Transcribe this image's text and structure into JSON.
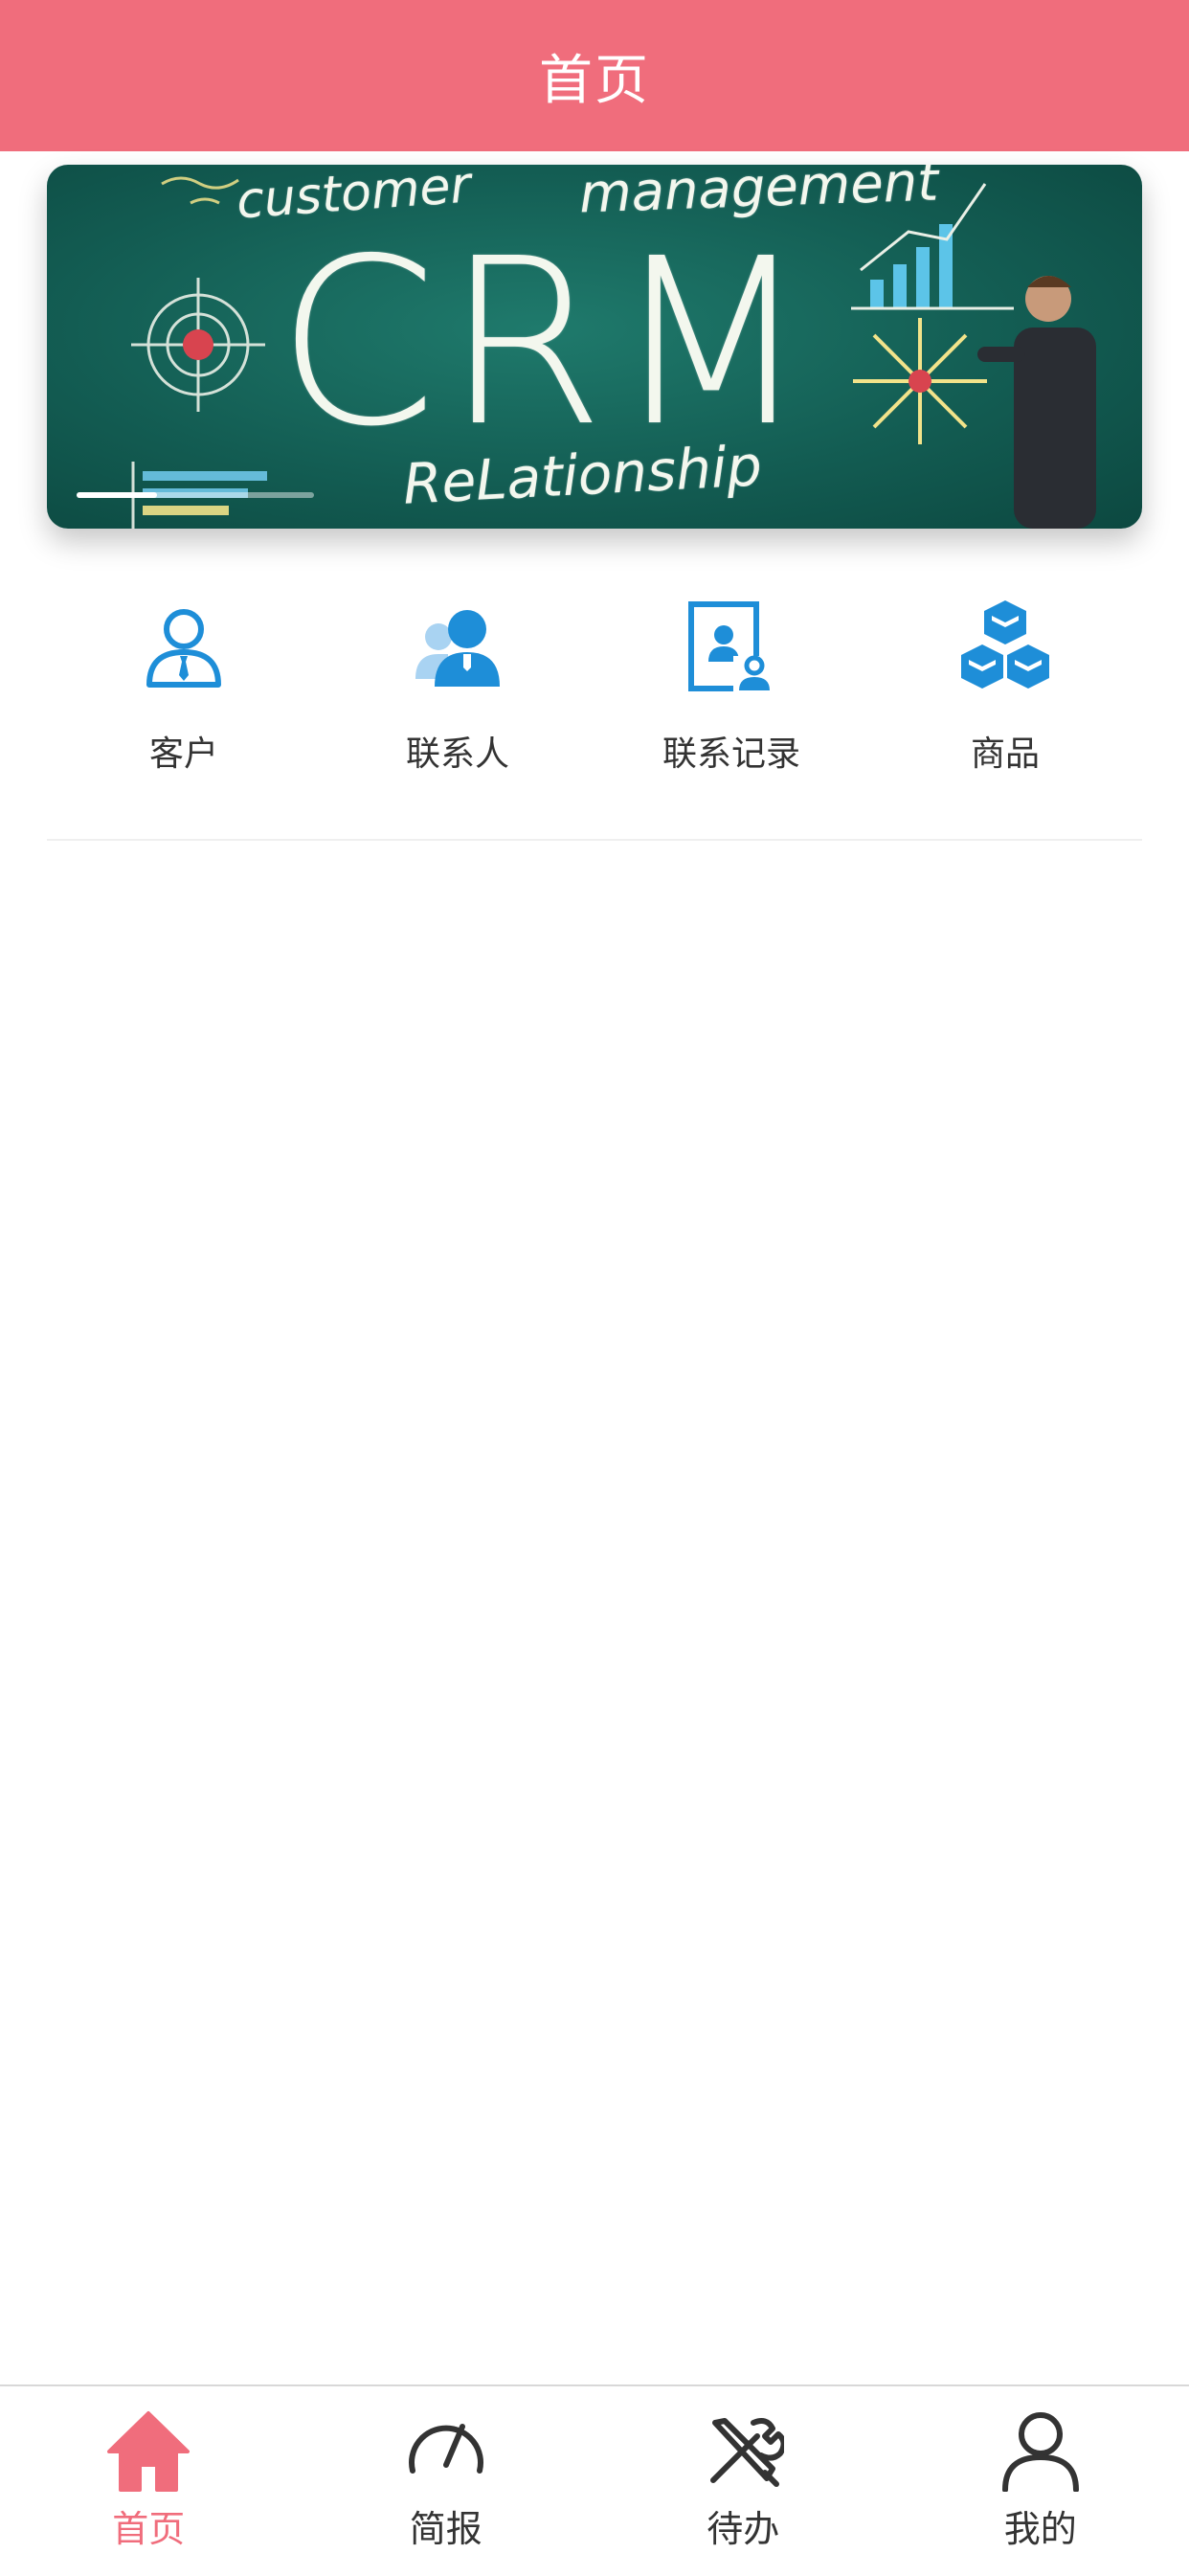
{
  "header": {
    "title": "首页"
  },
  "banner": {
    "texts": {
      "customer": "customer",
      "management": "management",
      "crm": "CRM",
      "relationship": "ReLationship"
    }
  },
  "quick_links": [
    {
      "label": "客户",
      "icon": "customer-icon"
    },
    {
      "label": "联系人",
      "icon": "contact-person-icon"
    },
    {
      "label": "联系记录",
      "icon": "contact-record-icon"
    },
    {
      "label": "商品",
      "icon": "product-cubes-icon"
    }
  ],
  "tabbar": {
    "items": [
      {
        "label": "首页",
        "icon": "home-icon",
        "active": true
      },
      {
        "label": "简报",
        "icon": "speedometer-icon",
        "active": false
      },
      {
        "label": "待办",
        "icon": "tools-icon",
        "active": false
      },
      {
        "label": "我的",
        "icon": "user-icon",
        "active": false
      }
    ]
  },
  "colors": {
    "primary": "#f06d7c",
    "icon_blue": "#1e8ed8",
    "text": "#333333"
  }
}
